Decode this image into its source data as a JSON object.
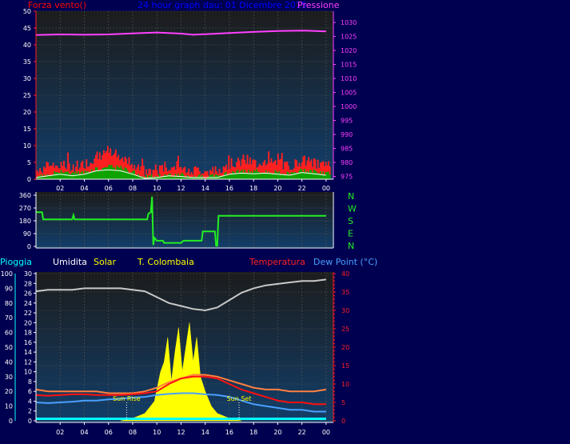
{
  "colors": {
    "background": "#000050",
    "plot_top": "#1a1a1a",
    "plot_bottom": "#123e6a",
    "wind_speed": "#ff2020",
    "wind_gust": "#00aa00",
    "wind_avg": "#ffffff",
    "pressure": "#ff40ff",
    "direction": "#22ee22",
    "humidity": "#c8c8c8",
    "solar": "#ffff00",
    "outdoor_temp": "#ff8040",
    "temperature": "#ff1010",
    "dew_point": "#4aa0ff",
    "rain": "#00ffff",
    "axis_blue": "#0000ff"
  },
  "header": {
    "left_label": "Forza vento()",
    "title": "24 hour graph dau: 01 Dicembre 2015",
    "right_label": "Pressione"
  },
  "direction_labels": [
    "N",
    "W",
    "S",
    "E",
    "N"
  ],
  "bottom_legend": {
    "rain": "Pioggia",
    "humidity": "Umidita",
    "solar": "Solar",
    "station": "T. Colombaia",
    "temperature": "Temperatura",
    "dew_point": "Dew Point (°C)"
  },
  "sun": {
    "rise": "Sun Rise",
    "set": "Sun Set",
    "rise_hour": 7.5,
    "set_hour": 16.8
  },
  "chart_data": [
    {
      "type": "line",
      "name_left": "Forza vento()",
      "name_right": "Pressione",
      "x_ticks": [
        "02",
        "04",
        "06",
        "08",
        "10",
        "12",
        "14",
        "16",
        "18",
        "20",
        "22",
        "00"
      ],
      "y_left_ticks": [
        0,
        5,
        10,
        15,
        20,
        25,
        30,
        35,
        40,
        45,
        50
      ],
      "y_left_lim": [
        0,
        50
      ],
      "y_right_ticks": [
        975,
        980,
        985,
        990,
        995,
        1000,
        1005,
        1010,
        1015,
        1020,
        1025,
        1030
      ],
      "y_right_lim": [
        974,
        1034
      ],
      "pressure": {
        "x": [
          0,
          2,
          4,
          6,
          8,
          10,
          12,
          13,
          14,
          16,
          18,
          20,
          22,
          24
        ],
        "y": [
          1025.5,
          1025.7,
          1025.6,
          1025.7,
          1026.1,
          1026.4,
          1026.0,
          1025.6,
          1025.8,
          1026.2,
          1026.6,
          1026.9,
          1027.1,
          1026.8
        ]
      },
      "wind_avg": {
        "x": [
          0,
          1,
          2,
          3,
          4,
          5,
          6,
          7,
          8,
          9,
          10,
          11,
          12,
          13,
          14,
          15,
          16,
          17,
          18,
          19,
          20,
          21,
          22,
          23,
          24
        ],
        "y": [
          0.5,
          1.0,
          1.5,
          1.0,
          1.5,
          2.5,
          2.8,
          2.5,
          1.5,
          0.3,
          0.5,
          1.0,
          0.8,
          0.5,
          0.5,
          0.5,
          1.5,
          1.8,
          1.6,
          1.8,
          1.5,
          1.2,
          2.0,
          1.6,
          1.2
        ]
      }
    },
    {
      "type": "line",
      "name": "wind direction",
      "y_ticks": [
        0,
        90,
        180,
        270,
        360
      ],
      "y_lim": [
        0,
        360
      ],
      "x": [
        0,
        0.5,
        0.6,
        3.0,
        3.1,
        3.2,
        9.2,
        9.3,
        9.5,
        9.6,
        9.7,
        9.8,
        10.0,
        10.5,
        10.6,
        12.0,
        12.2,
        13.7,
        13.8,
        14.8,
        14.9,
        15.0,
        15.1,
        24
      ],
      "y": [
        240,
        240,
        190,
        190,
        220,
        190,
        190,
        230,
        240,
        350,
        10,
        60,
        40,
        40,
        25,
        25,
        40,
        40,
        105,
        105,
        5,
        5,
        215,
        215
      ]
    },
    {
      "type": "line",
      "y_left_rain_ticks": [
        0,
        2,
        4,
        6,
        8,
        10,
        12,
        14,
        16,
        18,
        20,
        22,
        24,
        26,
        28,
        30
      ],
      "y_left_pct_ticks": [
        0,
        10,
        20,
        30,
        40,
        50,
        60,
        70,
        80,
        90,
        100
      ],
      "y_right_ticks": [
        0,
        5,
        10,
        15,
        20,
        25,
        30,
        35,
        40
      ],
      "y_right_lim": [
        0,
        40
      ],
      "humidity": {
        "x": [
          0,
          1,
          2,
          3,
          4,
          5,
          6,
          7,
          8,
          9,
          10,
          11,
          12,
          13,
          14,
          15,
          16,
          17,
          18,
          19,
          20,
          21,
          22,
          23,
          24
        ],
        "y": [
          88,
          89,
          89,
          89,
          90,
          90,
          90,
          90,
          89,
          88,
          84,
          80,
          78,
          76,
          75,
          77,
          82,
          87,
          90,
          92,
          93,
          94,
          95,
          95,
          96
        ]
      },
      "temperature": {
        "x": [
          0,
          1,
          2,
          3,
          4,
          5,
          6,
          7,
          8,
          9,
          10,
          11,
          12,
          13,
          14,
          15,
          16,
          17,
          18,
          19,
          20,
          21,
          22,
          23,
          24
        ],
        "y": [
          7,
          6.8,
          7,
          7.2,
          7.2,
          7,
          7,
          7,
          7.2,
          7.5,
          8,
          10,
          11.5,
          12,
          12,
          11.5,
          10,
          8.5,
          7.5,
          6.5,
          5.5,
          5,
          5,
          4.5,
          4.5
        ]
      },
      "outdoor_temp": {
        "x": [
          0,
          1,
          2,
          3,
          4,
          5,
          6,
          7,
          8,
          9,
          10,
          11,
          12,
          13,
          14,
          15,
          16,
          17,
          18,
          19,
          20,
          21,
          22,
          23,
          24
        ],
        "y": [
          8.5,
          8,
          8,
          8,
          8,
          8,
          7.5,
          7.5,
          7.5,
          8,
          9,
          10.5,
          11.5,
          12.5,
          12.5,
          12,
          11,
          10,
          9,
          8.5,
          8.5,
          8,
          8,
          8,
          8.5
        ]
      },
      "dew_point": {
        "x": [
          0,
          1,
          2,
          3,
          4,
          5,
          6,
          7,
          8,
          9,
          10,
          11,
          12,
          13,
          14,
          15,
          16,
          17,
          18,
          19,
          20,
          21,
          22,
          23,
          24
        ],
        "y": [
          5,
          4.8,
          5,
          5.2,
          5.5,
          5.5,
          5.8,
          6,
          6.3,
          6.5,
          7,
          7.3,
          7.5,
          7.5,
          7.2,
          7,
          6.5,
          5.5,
          4.5,
          4,
          3.5,
          3,
          3,
          2.5,
          2.5
        ]
      },
      "solar": {
        "x": [
          7.0,
          8.0,
          9.0,
          9.8,
          10.3,
          10.6,
          10.9,
          11.2,
          11.5,
          11.8,
          12.1,
          12.4,
          12.7,
          13.0,
          13.3,
          13.6,
          14.0,
          14.5,
          15.0,
          16.0,
          17.0
        ],
        "y": [
          0,
          0.5,
          1.5,
          4,
          10,
          12,
          17,
          8,
          14,
          19,
          10,
          15,
          20,
          12,
          17,
          9,
          6,
          3,
          1.5,
          0.5,
          0
        ]
      },
      "rain": {
        "x": [
          0,
          24
        ],
        "y": [
          0.4,
          0.4
        ]
      }
    }
  ]
}
